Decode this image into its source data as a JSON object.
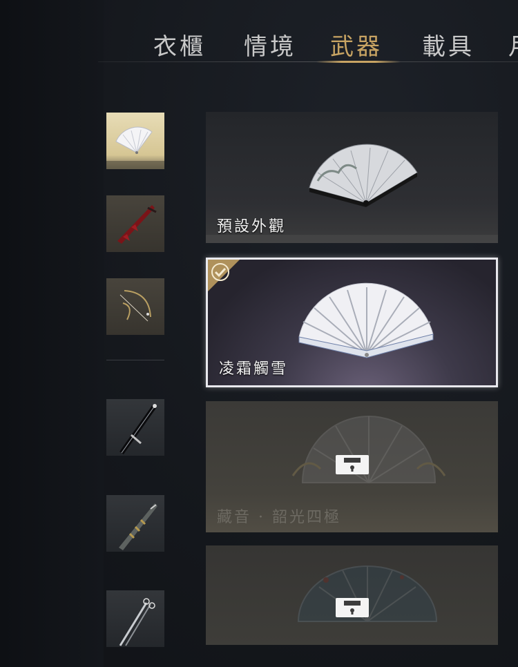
{
  "tabs": [
    {
      "label": "衣櫃",
      "active": false
    },
    {
      "label": "情境",
      "active": false
    },
    {
      "label": "武器",
      "active": true
    },
    {
      "label": "載具",
      "active": false
    },
    {
      "label": "月",
      "active": false
    }
  ],
  "colors": {
    "accent_gold": "#c8a463",
    "selected_border": "#e9e9ee",
    "background": "#15181d"
  },
  "thumbnails": [
    {
      "icon": "white-fan-icon",
      "selected": true
    },
    {
      "icon": "red-blade-icon",
      "selected": false
    },
    {
      "icon": "bow-icon",
      "selected": false
    },
    {
      "icon": "black-sword-icon",
      "selected": false
    },
    {
      "icon": "ornate-blade-icon",
      "selected": false
    },
    {
      "icon": "twin-blades-icon",
      "selected": false
    }
  ],
  "skins": [
    {
      "label": "預設外觀",
      "locked": false,
      "equipped": false
    },
    {
      "label": "凌霜觸雪",
      "locked": false,
      "equipped": true
    },
    {
      "label": "藏音 · 韶光四極",
      "locked": true,
      "equipped": false
    },
    {
      "label": "",
      "locked": true,
      "equipped": false
    }
  ]
}
